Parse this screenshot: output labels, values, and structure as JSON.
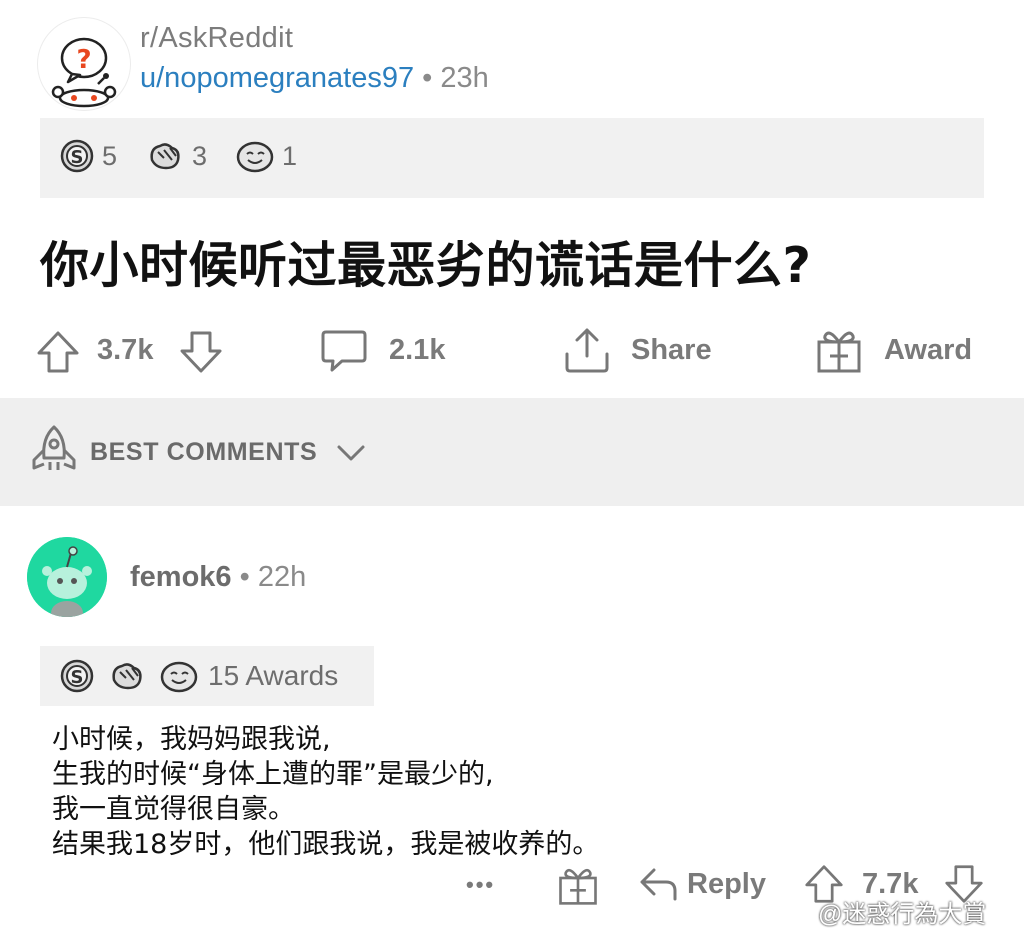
{
  "post": {
    "subreddit": "r/AskReddit",
    "author": "u/nopomegranates97",
    "separator": "•",
    "age": "23h",
    "awards": [
      {
        "icon": "silver-award-icon",
        "count": "5"
      },
      {
        "icon": "helpful-award-icon",
        "count": "3"
      },
      {
        "icon": "wholesome-award-icon",
        "count": "1"
      }
    ],
    "title": "你小时候听过最恶劣的谎话是什么?",
    "upvotes": "3.7k",
    "comments": "2.1k",
    "share_label": "Share",
    "award_label": "Award"
  },
  "sort": {
    "label": "BEST COMMENTS"
  },
  "comment": {
    "author": "femok6",
    "separator": "•",
    "age": "22h",
    "awards_label": "15 Awards",
    "body": [
      "小时候，我妈妈跟我说,",
      "生我的时候“身体上遭的罪”是最少的,",
      "我一直觉得很自豪。",
      "结果我18岁时，他们跟我说，我是被收养的。"
    ],
    "more_label": "•••",
    "reply_label": "Reply",
    "score": "7.7k"
  },
  "watermark": "@迷惑行為大賞",
  "colors": {
    "link": "#2b7fbf",
    "comment_avatar": "#1fd8a0",
    "muted_text": "#7a7a7a",
    "strip_bg": "#f1f1f1"
  }
}
